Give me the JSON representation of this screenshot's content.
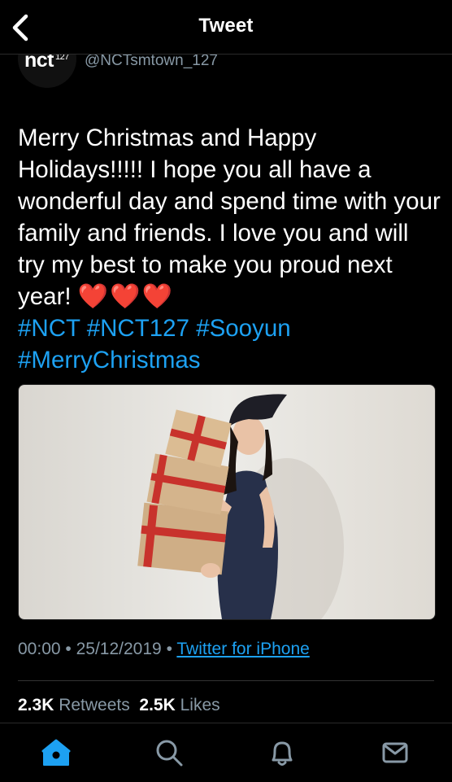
{
  "header": {
    "title": "Tweet"
  },
  "account": {
    "avatar_text": "nct",
    "avatar_sup": "127",
    "handle": "@NCTsmtown_127"
  },
  "tweet": {
    "body": "Merry Christmas and Happy Holidays!!!!! I hope you all have a wonderful day and spend time with your family and friends. I love you and will try my best to make you proud next year!",
    "hearts": "❤️❤️❤️",
    "hashtags": [
      "#NCT",
      "#NCT127",
      "#Sooyun",
      "#MerryChristmas"
    ]
  },
  "meta": {
    "time": "00:00",
    "sep1": "•",
    "date": "25/12/2019",
    "sep2": "•",
    "source": "Twitter for iPhone"
  },
  "stats": {
    "retweets_count": "2.3K",
    "retweets_label": "Retweets",
    "likes_count": "2.5K",
    "likes_label": "Likes"
  },
  "tabbar": {
    "items": [
      "home-icon",
      "search-icon",
      "notifications-icon",
      "messages-icon"
    ]
  },
  "colors": {
    "accent": "#1da1f2",
    "muted": "#8899a6",
    "heart": "#e0245e",
    "background": "#000000"
  }
}
